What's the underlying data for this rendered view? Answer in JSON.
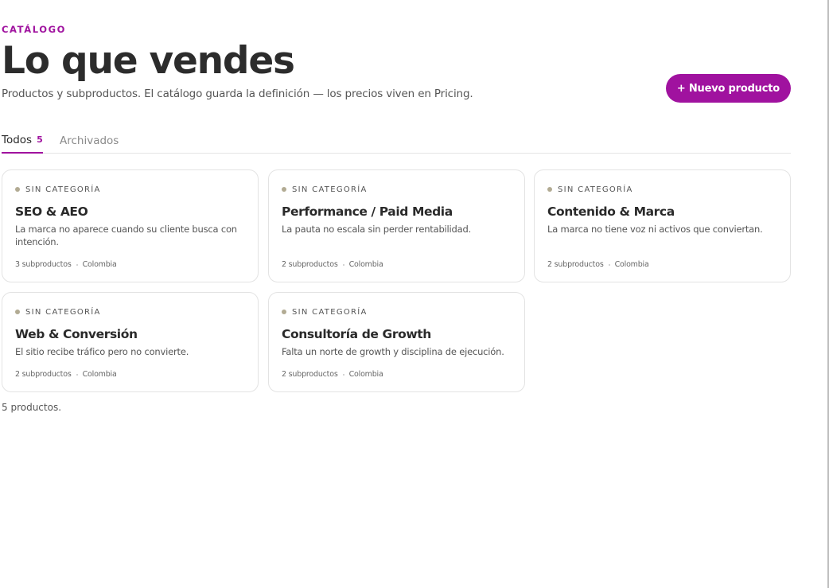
{
  "header": {
    "eyebrow": "CATÁLOGO",
    "title": "Lo que vendes",
    "subtitle": "Productos y subproductos. El catálogo guarda la definición — los precios viven en Pricing.",
    "new_button_label": "+ Nuevo producto"
  },
  "tabs": [
    {
      "label": "Todos",
      "count": "5",
      "active": true
    },
    {
      "label": "Archivados",
      "active": false
    }
  ],
  "products": [
    {
      "category": "SIN CATEGORÍA",
      "title": "SEO & AEO",
      "description": "La marca no aparece cuando su cliente busca con intención.",
      "subproducts": "3 subproductos",
      "region": "Colombia"
    },
    {
      "category": "SIN CATEGORÍA",
      "title": "Performance / Paid Media",
      "description": "La pauta no escala sin perder rentabilidad.",
      "subproducts": "2 subproductos",
      "region": "Colombia"
    },
    {
      "category": "SIN CATEGORÍA",
      "title": "Contenido & Marca",
      "description": "La marca no tiene voz ni activos que conviertan.",
      "subproducts": "2 subproductos",
      "region": "Colombia"
    },
    {
      "category": "SIN CATEGORÍA",
      "title": "Web & Conversión",
      "description": "El sitio recibe tráfico pero no convierte.",
      "subproducts": "2 subproductos",
      "region": "Colombia"
    },
    {
      "category": "SIN CATEGORÍA",
      "title": "Consultoría de Growth",
      "description": "Falta un norte de growth y disciplina de ejecución.",
      "subproducts": "2 subproductos",
      "region": "Colombia"
    }
  ],
  "footer": {
    "count_text": "5 productos."
  },
  "colors": {
    "accent": "#a0129f",
    "category_dot": "#b2ab93"
  }
}
